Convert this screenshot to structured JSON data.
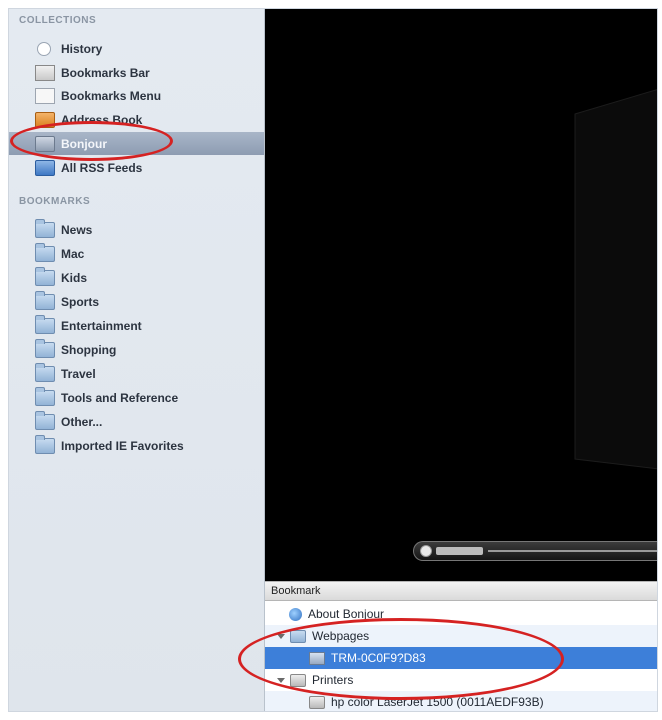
{
  "sidebar": {
    "collections_header": "COLLECTIONS",
    "collections": [
      {
        "label": "History",
        "icon": "clock-icon"
      },
      {
        "label": "Bookmarks Bar",
        "icon": "bookmarks-bar-icon"
      },
      {
        "label": "Bookmarks Menu",
        "icon": "bookmarks-menu-icon"
      },
      {
        "label": "Address Book",
        "icon": "address-book-icon"
      },
      {
        "label": "Bonjour",
        "icon": "bonjour-icon",
        "selected": true
      },
      {
        "label": "All RSS Feeds",
        "icon": "rss-icon"
      }
    ],
    "bookmarks_header": "BOOKMARKS",
    "bookmarks": [
      {
        "label": "News",
        "icon": "folder-icon"
      },
      {
        "label": "Mac",
        "icon": "folder-icon"
      },
      {
        "label": "Kids",
        "icon": "folder-icon"
      },
      {
        "label": "Sports",
        "icon": "folder-icon"
      },
      {
        "label": "Entertainment",
        "icon": "folder-icon"
      },
      {
        "label": "Shopping",
        "icon": "folder-icon"
      },
      {
        "label": "Travel",
        "icon": "folder-icon"
      },
      {
        "label": "Tools and Reference",
        "icon": "folder-icon"
      },
      {
        "label": "Other...",
        "icon": "folder-icon"
      },
      {
        "label": "Imported IE Favorites",
        "icon": "folder-icon"
      }
    ]
  },
  "table": {
    "header": "Bookmark",
    "rows": [
      {
        "label": "About Bonjour",
        "icon": "globe-icon",
        "indent": 1
      },
      {
        "label": "Webpages",
        "icon": "folder-icon",
        "indent": 0,
        "disclosure": "open"
      },
      {
        "label": "TRM-0C0F9?D83",
        "icon": "bonjour-icon",
        "indent": 2,
        "selected": true
      },
      {
        "label": "Printers",
        "icon": "printer-icon",
        "indent": 0,
        "disclosure": "open"
      },
      {
        "label": "hp color LaserJet 1500 (0011AEDF93B)",
        "icon": "printer-icon",
        "indent": 2
      }
    ]
  },
  "video": {
    "progress": 0.21
  },
  "colors": {
    "annotation": "#d52222",
    "selection": "#3d7fd9",
    "sidebar_bg": "#e4eaf1"
  }
}
